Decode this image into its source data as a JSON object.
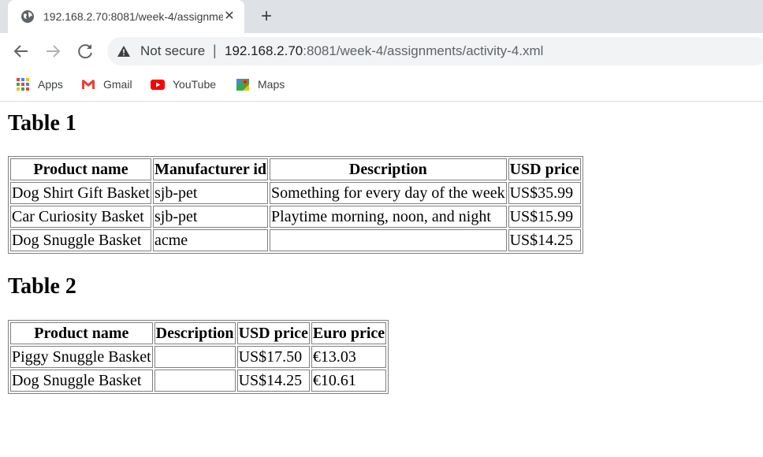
{
  "browser": {
    "tab_title": "192.168.2.70:8081/week-4/assignments/activity-4.xml",
    "security_label": "Not secure",
    "url_host": "192.168.2.70",
    "url_rest": ":8081/week-4/assignments/activity-4.xml"
  },
  "bookmarks": [
    {
      "label": "Apps",
      "icon": "apps-grid-icon"
    },
    {
      "label": "Gmail",
      "icon": "gmail-icon"
    },
    {
      "label": "YouTube",
      "icon": "youtube-icon"
    },
    {
      "label": "Maps",
      "icon": "maps-icon"
    }
  ],
  "table1": {
    "title": "Table 1",
    "headers": [
      "Product name",
      "Manufacturer id",
      "Description",
      "USD price"
    ],
    "rows": [
      [
        "Dog Shirt Gift Basket",
        "sjb-pet",
        "Something for every day of the week",
        "US$35.99"
      ],
      [
        "Car Curiosity Basket",
        "sjb-pet",
        "Playtime morning, noon, and night",
        "US$15.99"
      ],
      [
        "Dog Snuggle Basket",
        "acme",
        "",
        "US$14.25"
      ]
    ]
  },
  "table2": {
    "title": "Table 2",
    "headers": [
      "Product name",
      "Description",
      "USD price",
      "Euro price"
    ],
    "rows": [
      [
        "Piggy Snuggle Basket",
        "",
        "US$17.50",
        "€13.03"
      ],
      [
        "Dog Snuggle Basket",
        "",
        "US$14.25",
        "€10.61"
      ]
    ]
  }
}
